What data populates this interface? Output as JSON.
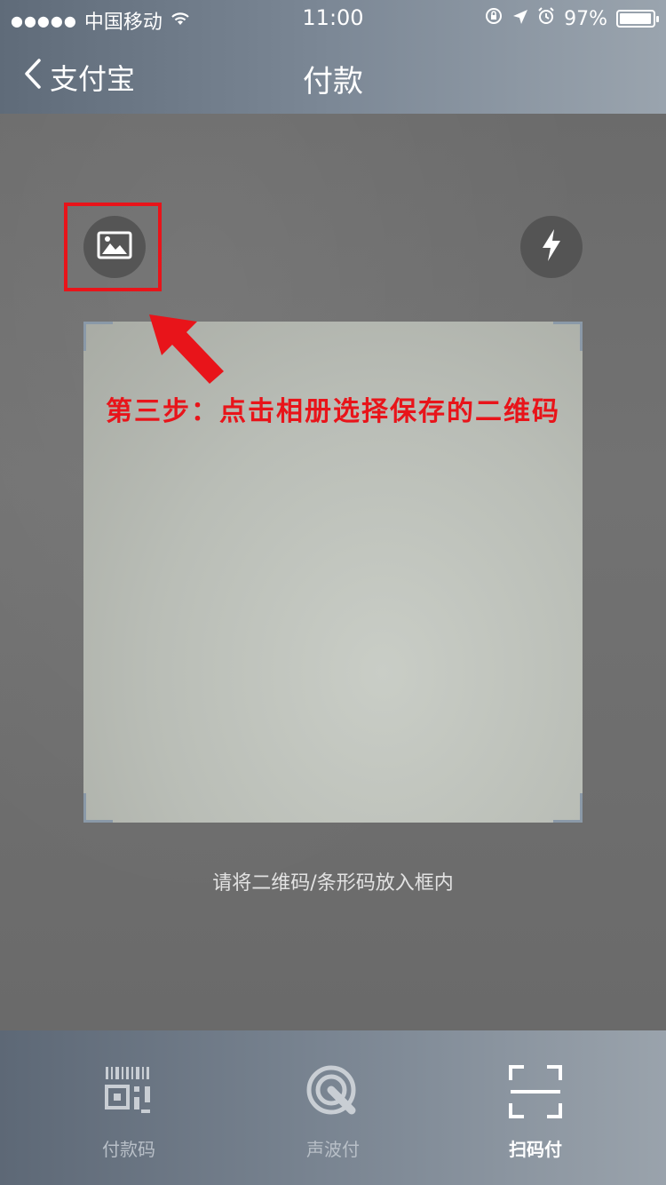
{
  "status_bar": {
    "signal_dots": "●●●●●",
    "carrier": "中国移动",
    "time": "11:00",
    "battery_percent": "97%",
    "battery_level": 0.97
  },
  "nav": {
    "back_label": "支付宝",
    "title": "付款"
  },
  "scanner": {
    "instruction": "第三步：点击相册选择保存的二维码",
    "hint": "请将二维码/条形码放入框内"
  },
  "tabs": [
    {
      "label": "付款码",
      "icon": "barcode-icon",
      "active": false
    },
    {
      "label": "声波付",
      "icon": "sound-wave-icon",
      "active": false
    },
    {
      "label": "扫码付",
      "icon": "scan-icon",
      "active": true
    }
  ],
  "colors": {
    "annotation_red": "#e8141a",
    "bar_gradient_start": "#5f6b79",
    "bar_gradient_end": "#9aa4ae"
  }
}
